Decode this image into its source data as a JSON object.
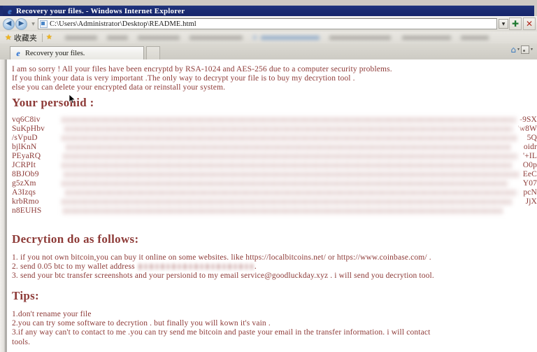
{
  "window": {
    "title": "Recovery your files. - Windows Internet Explorer",
    "title_icon": "ie-logo-icon"
  },
  "navigation": {
    "back_icon": "back-arrow-icon",
    "forward_icon": "forward-arrow-icon",
    "recent_pages_icon": "chevron-down-icon",
    "address_value": "C:\\Users\\Administrator\\Desktop\\README.html",
    "address_favicon": "html-document-icon",
    "address_dropdown_icon": "chevron-down-icon",
    "refresh_icon": "refresh-icon",
    "refresh_glyph": "✚",
    "stop_icon": "stop-icon",
    "stop_glyph": "✕"
  },
  "favorites_bar": {
    "star_icon": "star-icon",
    "label": "收藏夹",
    "add_icon": "add-favorite-icon"
  },
  "tabs": {
    "active": {
      "title": "Recovery your files.",
      "icon": "ie-page-icon"
    },
    "new_tab_icon": "new-tab-icon",
    "home_icon": "home-icon",
    "feeds_icon": "rss-feed-icon",
    "caret_glyph": "▾"
  },
  "page": {
    "intro": [
      "I am so sorry ! All your files have been encryptd by RSA-1024 and AES-256 due to a computer security problems.",
      "If you think your data is very important .The only way to decrypt your file is to buy my decrytion tool .",
      "else you can delete your encrypted data or reinstall your system."
    ],
    "personid_heading": "Your personid :",
    "personid_lines": [
      {
        "prefix": "vq6C8iv",
        "suffix": "-9SX"
      },
      {
        "prefix": "SuKpHbv",
        "suffix": "'w8W"
      },
      {
        "prefix": "/sVpuD",
        "suffix": "5Q"
      },
      {
        "prefix": "bjlKnN",
        "suffix": "oidr"
      },
      {
        "prefix": "PEyaRQ",
        "suffix": "'+IL"
      },
      {
        "prefix": "JCRPIt",
        "suffix": "O0p"
      },
      {
        "prefix": "8BJOb9",
        "suffix": "EeC"
      },
      {
        "prefix": "g5zXm",
        "suffix": "Y07"
      },
      {
        "prefix": "A3Izqs",
        "suffix": "pcN"
      },
      {
        "prefix": "krbRmo",
        "suffix": "JjX"
      },
      {
        "prefix": "n8EUHS",
        "suffix": ""
      }
    ],
    "decrytion_heading": "Decrytion do as follows:",
    "decrytion_steps_pre": [
      "1. if you not own bitcoin,you can buy it online on some websites. like https://localbitcoins.net/ or https://www.coinbase.com/ .",
      "2. send 0.05 btc to my wallet address "
    ],
    "decrytion_step2_tail": ".",
    "decrytion_step3": "3. send your btc transfer screenshots and your persionid to my email service@goodluckday.xyz . i will send you decrytion tool.",
    "tips_heading": "Tips:",
    "tips": [
      "1.don't rename your file",
      "2.you can try some software to decrytion . but finally you will kown it's vain .",
      "3.if any way can't to contact to me .you can try send me bitcoin and paste your email in the transfer information. i will contact",
      "tools."
    ]
  },
  "colors": {
    "text_red": "#8d3a37",
    "titlebar_blue": "#1b2c72",
    "chrome_gray": "#dedcd6",
    "page_bg": "#ffffff"
  }
}
